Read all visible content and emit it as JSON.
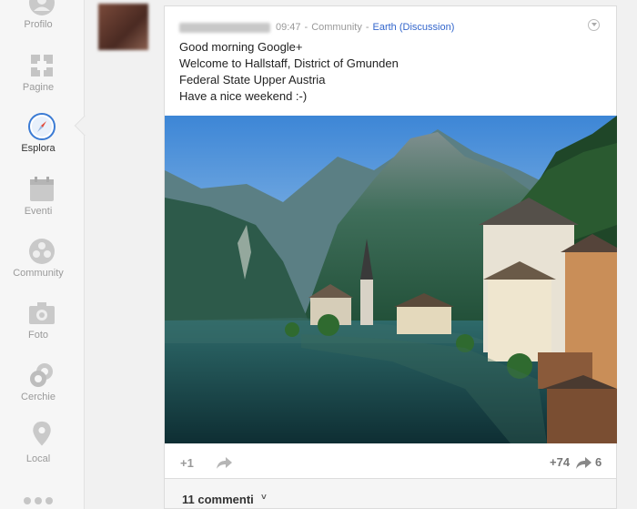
{
  "sidebar": {
    "items": [
      {
        "label": "Profilo",
        "icon": "profile-icon"
      },
      {
        "label": "Pagine",
        "icon": "pages-icon"
      },
      {
        "label": "Esplora",
        "icon": "compass-icon",
        "active": true
      },
      {
        "label": "Eventi",
        "icon": "calendar-icon"
      },
      {
        "label": "Community",
        "icon": "community-icon"
      },
      {
        "label": "Foto",
        "icon": "camera-icon"
      },
      {
        "label": "Cerchie",
        "icon": "circles-icon"
      },
      {
        "label": "Local",
        "icon": "map-pin-icon"
      }
    ],
    "more_icon": "more-dots-icon"
  },
  "post": {
    "time": "09:47",
    "community": "Community",
    "category": "Earth (Discussion)",
    "separator": "-",
    "lines": [
      "Good morning Google+",
      "Welcome to Hallstaff, District of Gmunden",
      "Federal State Upper Austria",
      "Have a nice weekend :-)"
    ],
    "plus_one_label": "+1",
    "plus_count": "+74",
    "share_count": "6"
  },
  "comments": {
    "label": "11 commenti",
    "chevron": "˅"
  },
  "colors": {
    "link": "#3366cc",
    "active_compass": "#3b7bd4"
  }
}
